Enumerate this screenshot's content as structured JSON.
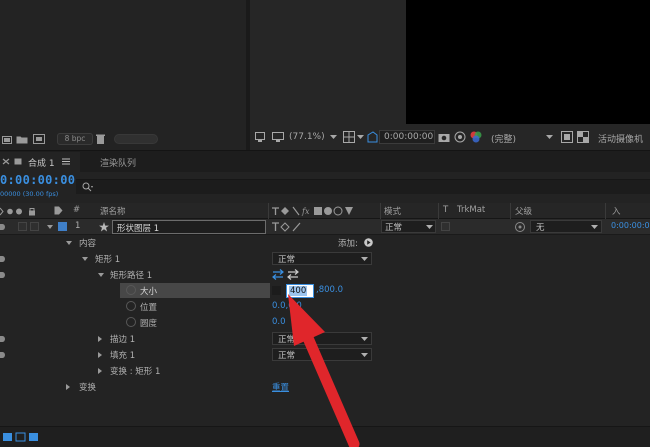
{
  "project": {
    "bpc_label": "8 bpc"
  },
  "viewer": {
    "zoom": "(77.1%)",
    "timecode": "0:00:00:00",
    "quality": "(完整)",
    "camera": "活动摄像机"
  },
  "tabs": [
    {
      "label": "合成 1"
    },
    {
      "label": "渲染队列"
    }
  ],
  "timeline": {
    "timecode": "0:00:00:00",
    "fps": "00000 (30.00 fps)",
    "columns": {
      "num": "#",
      "source": "源名称",
      "mode": "模式",
      "t": "T",
      "trkmat": "TrkMat",
      "parent": "父级",
      "in": "入"
    },
    "layer": {
      "index": "1",
      "name": "形状图层 1",
      "mode": "正常",
      "parent": "无",
      "in_time": "0:00:00:00"
    },
    "content_label": "内容",
    "add_label": "添加:",
    "rect_group": {
      "name": "矩形 1",
      "mode": "正常"
    },
    "rect_path": {
      "name": "矩形路径 1"
    },
    "size": {
      "label": "大小",
      "value_w": "400",
      "value_h": ",800.0"
    },
    "position": {
      "label": "位置",
      "value": "0.0,0.0"
    },
    "roundness": {
      "label": "圆度",
      "value": "0.0"
    },
    "stroke": {
      "name": "描边 1",
      "mode": "正常"
    },
    "fill": {
      "name": "填充 1",
      "mode": "正常"
    },
    "transform_rect": {
      "name": "变换 : 矩形 1"
    },
    "transform": {
      "label": "变换",
      "reset": "重置"
    }
  },
  "colors": {
    "accent_blue": "#3a8fe0",
    "arrow_red": "#e0262b"
  }
}
